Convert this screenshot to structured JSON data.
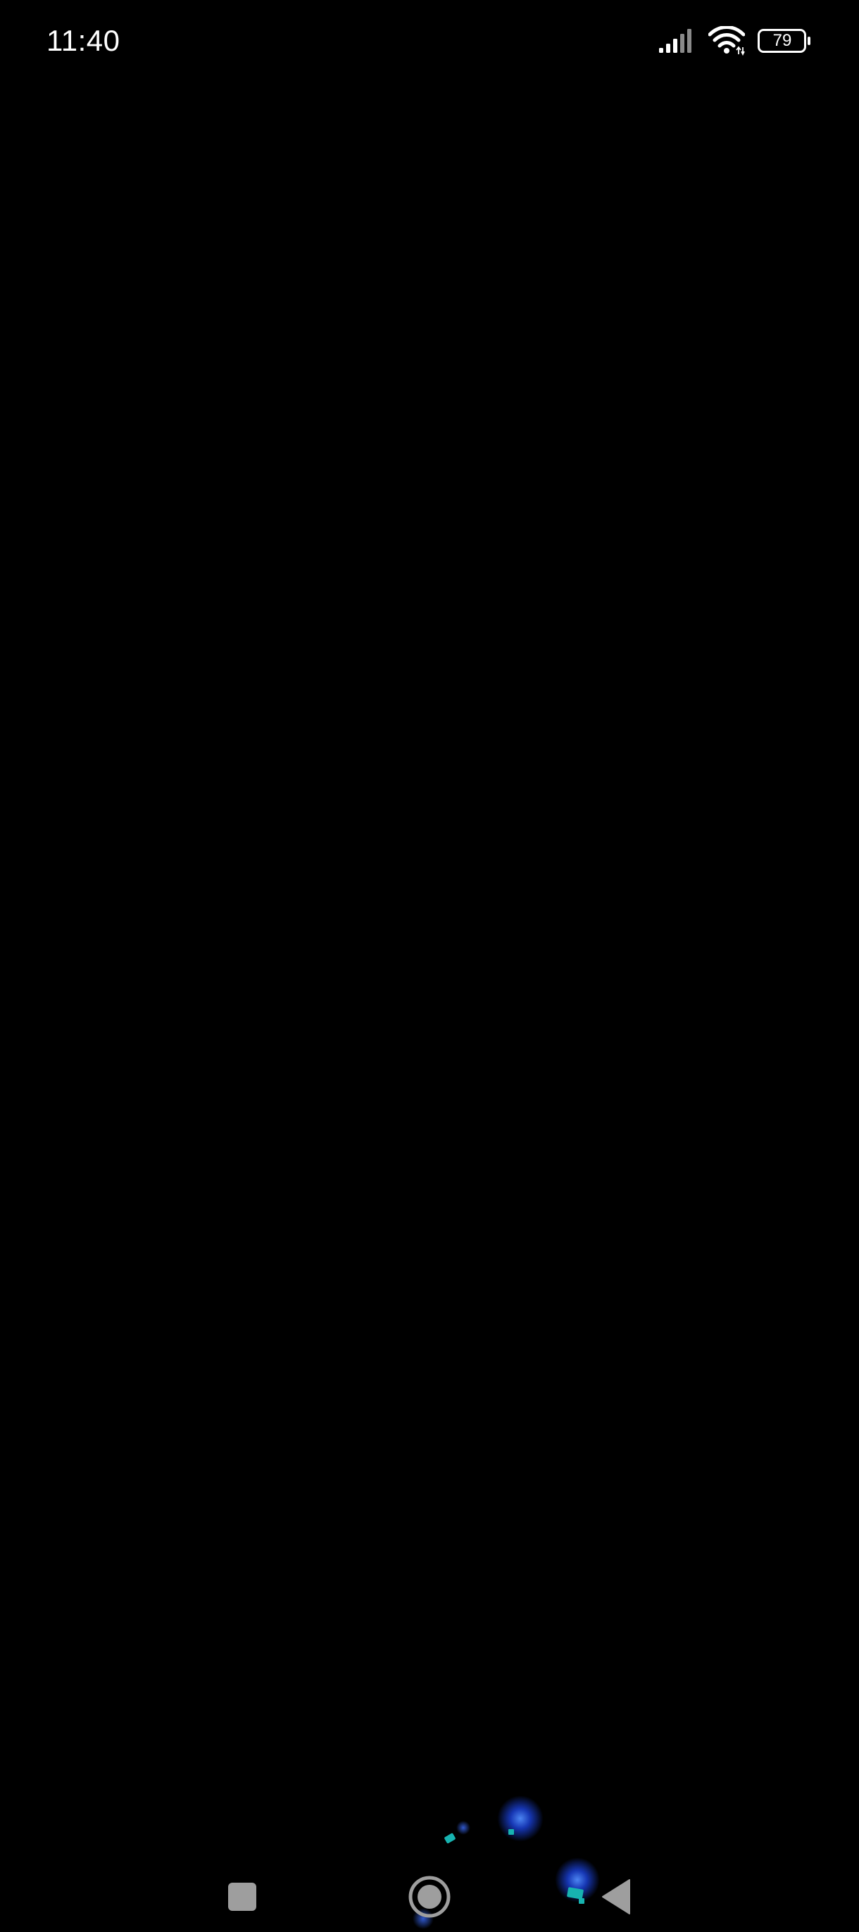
{
  "status_bar": {
    "time": "11:40",
    "battery": "79",
    "icons": [
      "signal-icon",
      "wifi-icon",
      "battery-icon"
    ]
  },
  "nav_bar": {
    "buttons": [
      "recents-icon",
      "home-icon",
      "back-icon"
    ]
  },
  "colors": {
    "background": "#000000",
    "foreground": "#ffffff",
    "nav_icon": "#9e9e9e",
    "glow_blue": "#1f4dff",
    "particle_teal": "#17b3b0"
  }
}
